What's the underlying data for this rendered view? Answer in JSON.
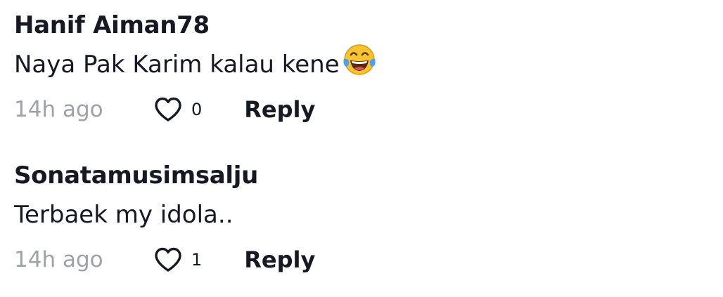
{
  "comments": [
    {
      "username": "Hanif Aiman78",
      "text": "Naya Pak Karim kalau kene",
      "emoji_icon": "face-with-tears-of-joy-icon",
      "time": "14h ago",
      "likes": "0",
      "reply_label": "Reply"
    },
    {
      "username": "Sonatamusimsalju",
      "text": "Terbaek my idola..",
      "time": "14h ago",
      "likes": "1",
      "reply_label": "Reply"
    }
  ],
  "colors": {
    "text": "#161823",
    "muted": "#a0a1a7",
    "emoji_face": "#f7c330",
    "emoji_tears": "#4aa3e8"
  }
}
